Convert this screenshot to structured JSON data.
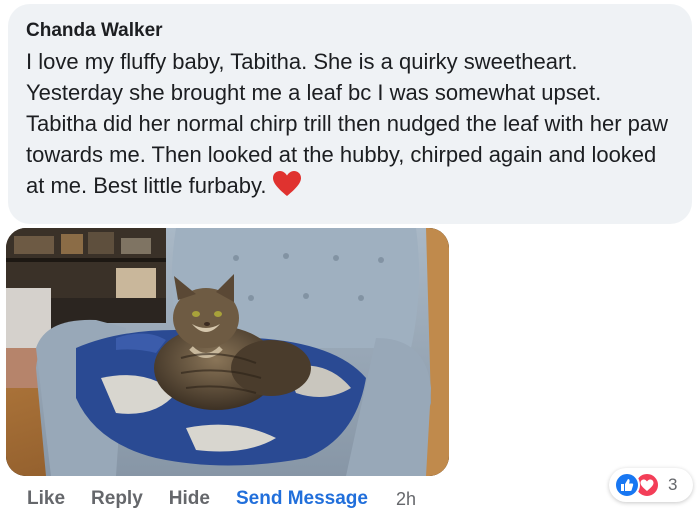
{
  "comment": {
    "author": "Chanda Walker",
    "text": "I love my fluffy baby, Tabitha. She is a quirky sweetheart. Yesterday she brought me a leaf bc I was somewhat upset. Tabitha did her normal chirp trill then nudged the leaf with her paw towards me. Then looked at the hubby, chirped again and looked at me. Best little furbaby.",
    "emoji": "heart-emoji"
  },
  "actions": {
    "like": "Like",
    "reply": "Reply",
    "hide": "Hide",
    "send_message": "Send Message",
    "time": "2h"
  },
  "reactions": {
    "icons": [
      "like-icon",
      "love-icon"
    ],
    "count": "3"
  },
  "colors": {
    "bubble_bg": "#eff2f5",
    "link_blue": "#216fdb",
    "action_gray": "#65676b",
    "like_blue": "#1877f2",
    "love_red": "#f33e58"
  }
}
